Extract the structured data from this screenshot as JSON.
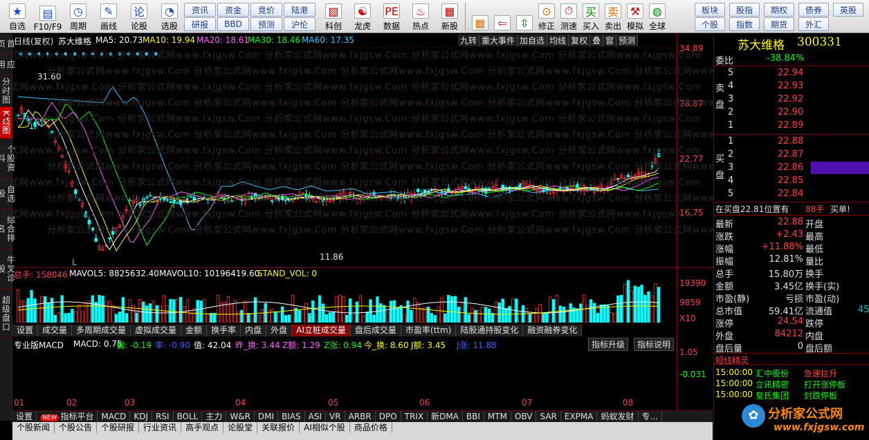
{
  "toolbar": {
    "items": [
      {
        "label": "自选",
        "icon": "star-icon",
        "sym": "★"
      },
      {
        "label": "F10/F9",
        "icon": "f10-icon",
        "sym": "▤"
      },
      {
        "label": "周期",
        "icon": "period-icon",
        "sym": "◷"
      },
      {
        "label": "画线",
        "icon": "pencil-icon",
        "sym": "✎"
      },
      {
        "label": "论股",
        "icon": "discuss-icon",
        "sym": "论"
      },
      {
        "label": "选股",
        "icon": "select-icon",
        "sym": "◔"
      }
    ],
    "grid1": [
      "资讯",
      "资金",
      "竞价",
      "陆港",
      "研报",
      "BBD",
      "预测",
      "沪伦"
    ],
    "items2": [
      {
        "label": "科创",
        "icon": "kechuang-icon",
        "sym": "▧"
      },
      {
        "label": "龙虎",
        "icon": "dragon-icon",
        "sym": "☯"
      },
      {
        "label": "数据",
        "icon": "pe-icon",
        "sym": "PE"
      },
      {
        "label": "热点",
        "icon": "hot-icon",
        "sym": "♨"
      },
      {
        "label": "新股",
        "icon": "newstock-icon",
        "sym": "▦"
      }
    ],
    "items3": [
      {
        "label": "",
        "icon": "color-grid-icon",
        "sym": "▦"
      },
      {
        "label": "",
        "icon": "back-arrow-icon",
        "sym": "⇦"
      },
      {
        "label": "",
        "icon": "up-down-icon",
        "sym": "⇳"
      },
      {
        "label": "修正",
        "icon": "fix-icon",
        "sym": "⊙"
      },
      {
        "label": "测速",
        "icon": "speed-icon",
        "sym": "⏱"
      },
      {
        "label": "买入",
        "icon": "buy-icon",
        "sym": "买"
      },
      {
        "label": "卖出",
        "icon": "sell-icon",
        "sym": "卖"
      },
      {
        "label": "模拟",
        "icon": "hammer-icon",
        "sym": "⚒"
      },
      {
        "label": "全球",
        "icon": "globe-icon",
        "sym": "◍"
      }
    ],
    "grid2": [
      "板块",
      "股指",
      "期权",
      "债券",
      "英股",
      "个股",
      "指数",
      "期货",
      "外汇"
    ]
  },
  "left_tabs": [
    "首页",
    "应用",
    "分时图",
    "K线图",
    "个股资料",
    "自选股",
    "综合排名",
    "牛叉诊股",
    "超级盘口"
  ],
  "chart_header": {
    "title": "日线(复权)",
    "name": "苏大维格",
    "ma5": "MA5: 20.73",
    "ma10": "MA10: 19.94",
    "ma20": "MA20: 18.61",
    "ma30": "MA30: 18.46",
    "ma60": "MA60: 17.35"
  },
  "chart_tools": [
    "九转",
    "重大事件",
    "加自选",
    "均线",
    "复权",
    "叠",
    "窗",
    "预测"
  ],
  "price_axis": [
    "34.89",
    "28.87",
    "22.77",
    "16.75"
  ],
  "annotations": {
    "high": "31.60",
    "low": "11.86",
    "l_marker": "L"
  },
  "vol_header": {
    "total": "总手: 158046",
    "mavol5": "MAVOL5: 8825632.40",
    "mavol10": "MAVOL10: 10196419.60",
    "stand": "STAND_VOL: 0"
  },
  "vol_axis": [
    "19390",
    "9859",
    "X10"
  ],
  "mid_tabs": [
    "设置",
    "成交量",
    "多周期成交量",
    "虚拟成交量",
    "金额",
    "换手率",
    "内盘",
    "外盘",
    "AI立桩成交量",
    "盘后成交量",
    "市盈率(ttm)",
    "陆股通持股变化",
    "融资融券变化"
  ],
  "macd_header": {
    "name": "专业版MACD",
    "macd": "MACD: 0.75",
    "pian": "偏: -0.19",
    "lv": "率: -0.90",
    "zhi": "值: 42.04",
    "zuo": "昨_换: 3.44",
    "zg": "Z额: 1.29",
    "zz": "Z涨: 0.94",
    "jin": "今_换: 8.60",
    "jl": "J额: 3.45",
    "jz": "J涨: 11.88"
  },
  "macd_buttons": [
    "指标升级",
    "指标说明"
  ],
  "macd_axis": [
    "1.05",
    "-0.031"
  ],
  "months": [
    "01",
    "02",
    "03",
    "04",
    "05",
    "06",
    "07",
    "08"
  ],
  "bottom_tabs": [
    "设置",
    "指标平台",
    "MACD",
    "KDJ",
    "RSI",
    "BOLL",
    "主力",
    "W&R",
    "DMI",
    "BIAS",
    "ASI",
    "VR",
    "ARBR",
    "DPO",
    "TRIX",
    "新DMA",
    "BBI",
    "MTM",
    "OBV",
    "SAR",
    "EXPMA",
    "蚂蚁发财",
    "专..."
  ],
  "bottom_links": [
    "个股新闻",
    "个股公告",
    "个股研报",
    "行业资讯",
    "高手观点",
    "论股堂",
    "关联报价",
    "AI相似个股",
    "商品价格"
  ],
  "quote": {
    "name": "苏大维格",
    "code": "300331",
    "weibi_label": "委比",
    "weibi": "-38.84%",
    "sell_label": "卖盘",
    "buy_label": "买盘",
    "sells": [
      {
        "n": "5",
        "p": "22.94"
      },
      {
        "n": "4",
        "p": "22.93"
      },
      {
        "n": "3",
        "p": "22.92"
      },
      {
        "n": "2",
        "p": "22.90"
      },
      {
        "n": "1",
        "p": "22.89"
      }
    ],
    "buys": [
      {
        "n": "1",
        "p": "22.88"
      },
      {
        "n": "2",
        "p": "22.87"
      },
      {
        "n": "3",
        "p": "22.86"
      },
      {
        "n": "4",
        "p": "22.85"
      },
      {
        "n": "5",
        "p": "22.84"
      }
    ],
    "info_left": "在买盘22.81位置有",
    "info_mid": "88手",
    "info_right": "买单!",
    "stats": [
      {
        "l": "最新",
        "v": "22.88",
        "r": "开盘",
        "c": "#ff4040"
      },
      {
        "l": "涨跌",
        "v": "+2.43",
        "r": "最高",
        "c": "#ff4040"
      },
      {
        "l": "涨幅",
        "v": "+11.88%",
        "r": "最低",
        "c": "#ff4040"
      },
      {
        "l": "振幅",
        "v": "12.81%",
        "r": "量比",
        "c": "#e0e0e0"
      },
      {
        "l": "总手",
        "v": "15.80万",
        "r": "换手",
        "c": "#e0e0e0"
      },
      {
        "l": "金额",
        "v": "3.45亿",
        "r": "换手(实)",
        "c": "#e0e0e0"
      },
      {
        "l": "市盈(静)",
        "v": "亏损",
        "r": "市盈(动)",
        "c": "#e0e0e0"
      },
      {
        "l": "总市值",
        "v": "59.41亿",
        "r": "流通值",
        "c": "#e0e0e0"
      },
      {
        "l": "涨停",
        "v": "24.54",
        "r": "跌停",
        "c": "#ff4040"
      },
      {
        "l": "外盘",
        "v": "84212",
        "r": "内盘",
        "c": "#ff4040"
      },
      {
        "l": "盘后量",
        "v": "0",
        "r": "盘后额",
        "c": "#e0e0e0"
      }
    ],
    "extra_right": "45",
    "sprite_title": "短线精灵",
    "sprite": [
      {
        "t": "15:00:00",
        "s": "汇中股份",
        "e": "急速拉升"
      },
      {
        "t": "15:00:00",
        "s": "立讯精密",
        "e": "打开涨停板"
      },
      {
        "t": "15:00:00",
        "s": "皇氏集团",
        "e": "封跌停板"
      }
    ],
    "logo": "分析家公式网",
    "site": "www.fxjgsw.com"
  },
  "watermark": "分析家公式网www.fxjgsw.Com"
}
